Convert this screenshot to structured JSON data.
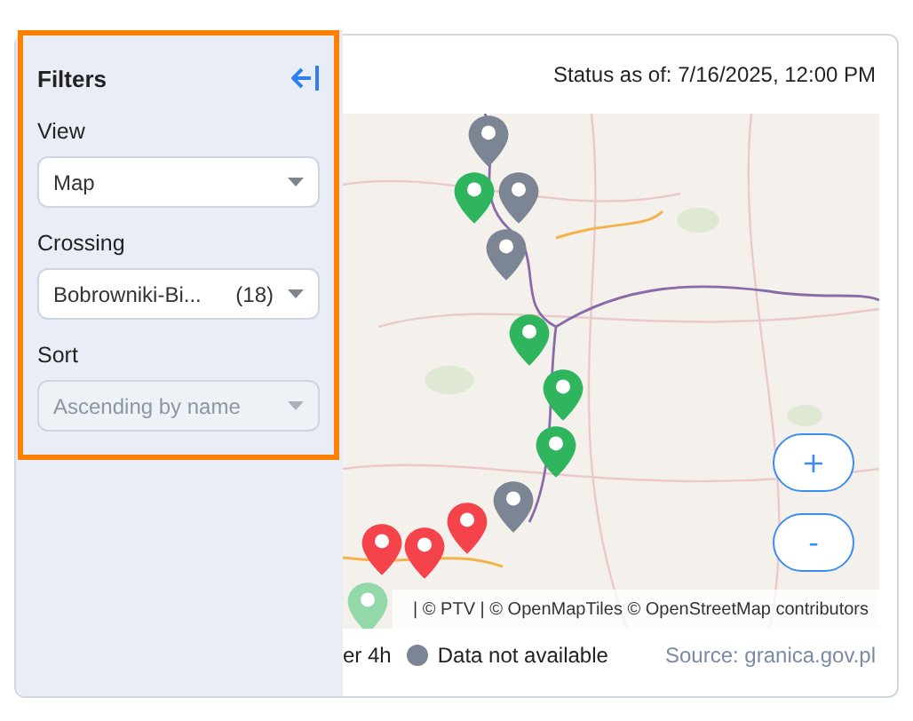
{
  "filters": {
    "title": "Filters",
    "fields": [
      {
        "label": "View",
        "value": "Map",
        "disabled": false
      },
      {
        "label": "Crossing",
        "value": "Bobrowniki-Bi...",
        "count": "(18)",
        "disabled": false
      },
      {
        "label": "Sort",
        "value": "Ascending by name",
        "disabled": true
      }
    ]
  },
  "status": "Status as of: 7/16/2025, 12:00 PM",
  "map": {
    "markers": [
      {
        "color": "#7b8593"
      },
      {
        "color": "#2fb55e"
      },
      {
        "color": "#7b8593"
      },
      {
        "color": "#7b8593"
      },
      {
        "color": "#2fb55e"
      },
      {
        "color": "#2fb55e"
      },
      {
        "color": "#2fb55e"
      },
      {
        "color": "#7b8593"
      },
      {
        "color": "#f4434a"
      },
      {
        "color": "#f4434a"
      },
      {
        "color": "#f4434a"
      },
      {
        "color": "#93d8a9"
      }
    ],
    "zoom_in": "+",
    "zoom_out": "-",
    "attribution": "| © PTV | © OpenMapTiles © OpenStreetMap contributors"
  },
  "legend": [
    {
      "label": "er 4h"
    },
    {
      "label": "Data not available",
      "color": "#7b8593"
    }
  ],
  "source": "Source: granica.gov.pl"
}
